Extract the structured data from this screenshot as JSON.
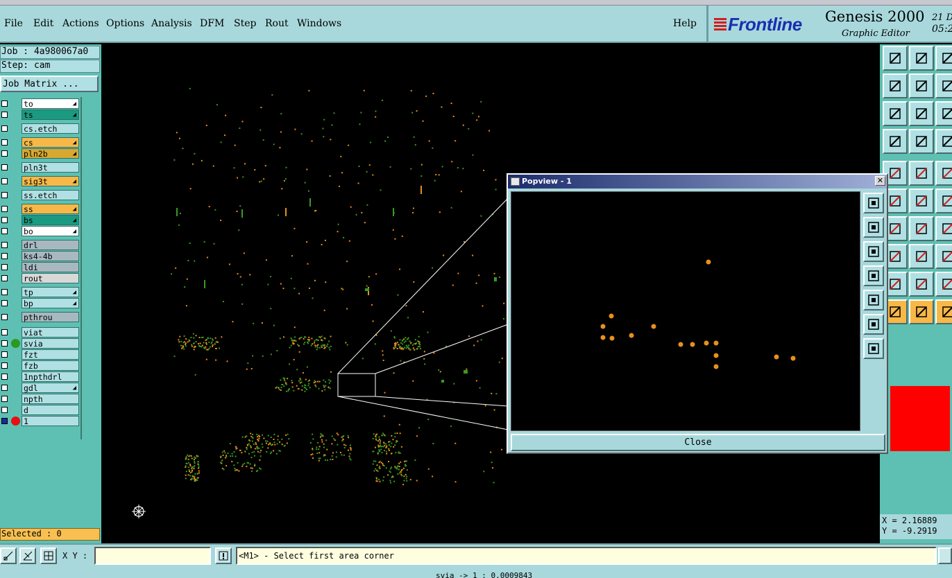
{
  "menubar": {
    "items": [
      "File",
      "Edit",
      "Actions",
      "Options",
      "Analysis",
      "DFM",
      "Step",
      "Rout",
      "Windows"
    ],
    "help": "Help"
  },
  "brand": {
    "logo": "Frontline",
    "title": "Genesis 2000",
    "subtitle": "Graphic Editor",
    "date": "21 De",
    "time": "05:2"
  },
  "job": {
    "job_label": "Job : 4a980067a0",
    "step_label": "Step: cam",
    "matrix_button": "Job Matrix ..."
  },
  "layers": [
    {
      "name": "to",
      "color": "#ffffff",
      "flag": true
    },
    {
      "name": "ts",
      "color": "#1a9a80",
      "flag": true
    },
    {
      "name": "cs.etch",
      "color": "#b0e0e4",
      "flag": false
    },
    {
      "name": "cs",
      "color": "#f8b848",
      "flag": true
    },
    {
      "name": "pln2b",
      "color": "#d8a830",
      "flag": true
    },
    {
      "name": "pln3t",
      "color": "#b0e0e4",
      "flag": false
    },
    {
      "name": "sig3t",
      "color": "#f8b848",
      "flag": true
    },
    {
      "name": "ss.etch",
      "color": "#b0e0e4",
      "flag": false
    },
    {
      "name": "ss",
      "color": "#f8b848",
      "flag": true
    },
    {
      "name": "bs",
      "color": "#1a9a80",
      "flag": true
    },
    {
      "name": "bo",
      "color": "#ffffff",
      "flag": true
    },
    {
      "name": "drl",
      "color": "#a8b8c0",
      "flag": false
    },
    {
      "name": "ks4-4b",
      "color": "#a8b8c0",
      "flag": false
    },
    {
      "name": "ldi",
      "color": "#a8b8c0",
      "flag": false
    },
    {
      "name": "rout",
      "color": "#d8d8d8",
      "flag": false
    },
    {
      "name": "tp",
      "color": "#b0e0e4",
      "flag": true
    },
    {
      "name": "bp",
      "color": "#b0e0e4",
      "flag": true
    },
    {
      "name": "pthrou",
      "color": "#a8b8c0",
      "flag": false
    },
    {
      "name": "viat",
      "color": "#b0e0e4",
      "flag": false
    },
    {
      "name": "svia",
      "color": "#b0e0e4",
      "flag": false,
      "dot": "#2a9a20"
    },
    {
      "name": "fzt",
      "color": "#b0e0e4",
      "flag": false
    },
    {
      "name": "fzb",
      "color": "#b0e0e4",
      "flag": false
    },
    {
      "name": "1npthdrl",
      "color": "#b0e0e4",
      "flag": false
    },
    {
      "name": "gdl",
      "color": "#b0e0e4",
      "flag": true
    },
    {
      "name": "npth",
      "color": "#b0e0e4",
      "flag": false
    },
    {
      "name": "d",
      "color": "#b0e0e4",
      "flag": false
    },
    {
      "name": "1",
      "color": "#b0e0e4",
      "flag": false,
      "dot": "#e81010",
      "boxcolor": "#1a2aa0"
    }
  ],
  "selected": "Selected : 0",
  "popview": {
    "title": "Popview - 1",
    "close_button": "Close"
  },
  "coords": {
    "x": "X = 2.16889",
    "y": "Y = -9.2919"
  },
  "bottombar": {
    "xy_label": "X Y :",
    "xy_value": "",
    "message": "<M1> - Select first area corner",
    "status": "svia -> 1 : 0.0009843"
  },
  "colors": {
    "panel": "#5dc0b2",
    "chrome": "#a8d8dc",
    "pad_orange": "#e8901c",
    "pad_green": "#3a9a22"
  }
}
